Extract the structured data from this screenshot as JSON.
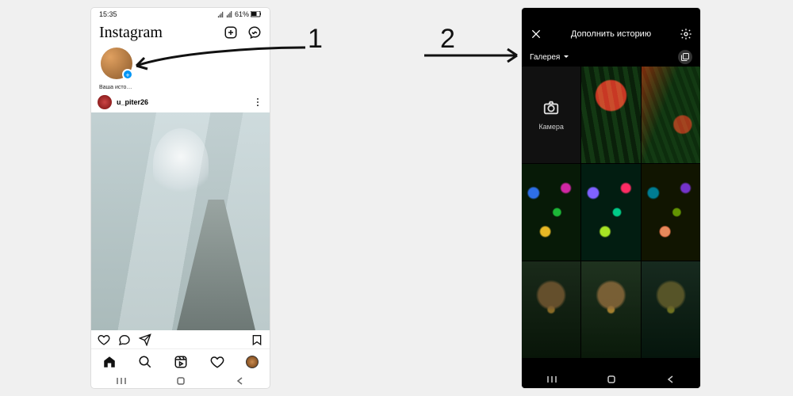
{
  "annotations": {
    "label1": "1",
    "label2": "2"
  },
  "phone1": {
    "status": {
      "time": "15:35",
      "battery": "61%"
    },
    "header": {
      "logo": "Instagram"
    },
    "story": {
      "your_story_label": "Ваша истор..."
    },
    "post": {
      "username": "u_piter26"
    }
  },
  "phone2": {
    "header": {
      "title": "Дополнить историю"
    },
    "gallery": {
      "source_label": "Галерея",
      "camera_label": "Камера"
    }
  }
}
